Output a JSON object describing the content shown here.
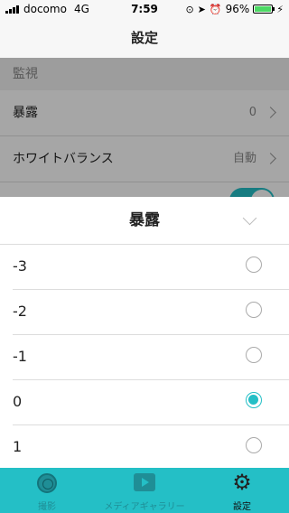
{
  "status_bar": {
    "carrier": "docomo",
    "network": "4G",
    "time": "7:59",
    "battery": "96%",
    "battery_level": 0.96
  },
  "nav": {
    "title": "設定"
  },
  "settings": {
    "section_title": "監視",
    "rows": [
      {
        "label": "暴露",
        "value": "0"
      },
      {
        "label": "ホワイトバランス",
        "value": "自動"
      }
    ],
    "toggle_on": true
  },
  "sheet": {
    "title": "暴露",
    "options": [
      {
        "label": "-3",
        "selected": false
      },
      {
        "label": "-2",
        "selected": false
      },
      {
        "label": "-1",
        "selected": false
      },
      {
        "label": "0",
        "selected": true
      },
      {
        "label": "1",
        "selected": false
      }
    ]
  },
  "tabs": [
    {
      "label": "撮影",
      "icon": "camera-icon"
    },
    {
      "label": "メディアギャラリー",
      "icon": "media-icon"
    },
    {
      "label": "設定",
      "icon": "gear-icon"
    }
  ],
  "colors": {
    "accent": "#24bfc6"
  }
}
